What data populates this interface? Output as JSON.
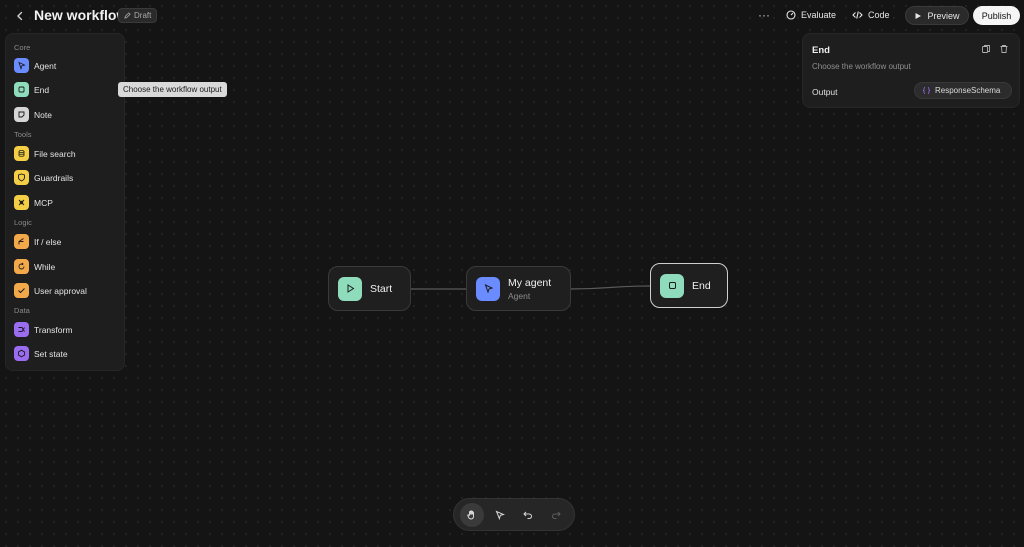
{
  "header": {
    "title": "New workflow",
    "badge": "Draft",
    "more_label": "···",
    "evaluate_label": "Evaluate",
    "code_label": "Code",
    "preview_label": "Preview",
    "publish_label": "Publish"
  },
  "sidebar": {
    "groups": [
      {
        "label": "Core",
        "items": [
          {
            "label": "Agent",
            "icon": "agent-pointer-icon",
            "color": "#6b8cff"
          },
          {
            "label": "End",
            "icon": "square-stop-icon",
            "color": "#8fdcbc"
          },
          {
            "label": "Note",
            "icon": "note-icon",
            "color": "#d6d6d6"
          }
        ]
      },
      {
        "label": "Tools",
        "items": [
          {
            "label": "File search",
            "icon": "database-icon",
            "color": "#f4cf45"
          },
          {
            "label": "Guardrails",
            "icon": "shield-icon",
            "color": "#f4cf45"
          },
          {
            "label": "MCP",
            "icon": "mcp-icon",
            "color": "#f4cf45"
          }
        ]
      },
      {
        "label": "Logic",
        "items": [
          {
            "label": "If / else",
            "icon": "branch-icon",
            "color": "#f3a84a"
          },
          {
            "label": "While",
            "icon": "loop-icon",
            "color": "#f3a84a"
          },
          {
            "label": "User approval",
            "icon": "approval-icon",
            "color": "#f3a84a"
          }
        ]
      },
      {
        "label": "Data",
        "items": [
          {
            "label": "Transform",
            "icon": "transform-icon",
            "color": "#9a6cf0"
          },
          {
            "label": "Set state",
            "icon": "state-icon",
            "color": "#9a6cf0"
          }
        ]
      }
    ]
  },
  "tooltip": {
    "text": "Choose the workflow output"
  },
  "inspector": {
    "title": "End",
    "description": "Choose the workflow output",
    "output_label": "Output",
    "output_value": "ResponseSchema"
  },
  "nodes": {
    "start": {
      "label": "Start",
      "color": "#8fdcbc"
    },
    "agent": {
      "label": "My agent",
      "sublabel": "Agent",
      "color": "#6b8cff"
    },
    "end": {
      "label": "End",
      "color": "#8fdcbc"
    }
  },
  "toolbar": {
    "tools": [
      "pan-hand-icon",
      "select-pointer-icon",
      "undo-icon",
      "redo-icon"
    ]
  }
}
